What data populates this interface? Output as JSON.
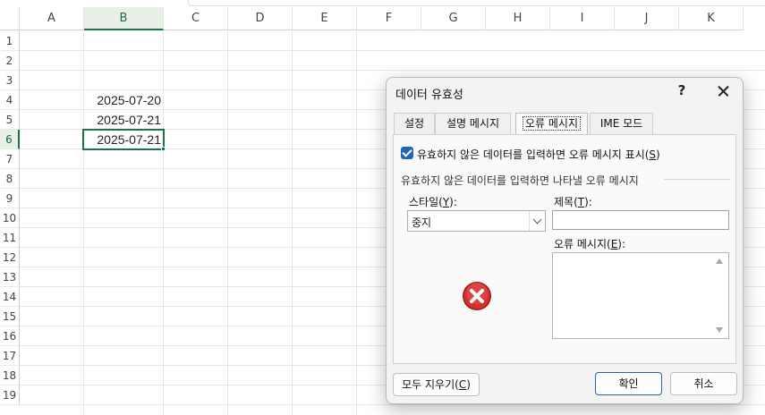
{
  "sheet": {
    "columns": [
      "A",
      "B",
      "C",
      "D",
      "E",
      "F",
      "G",
      "H",
      "I",
      "J",
      "K"
    ],
    "rows": [
      "1",
      "2",
      "3",
      "4",
      "5",
      "6",
      "7",
      "8",
      "9",
      "10",
      "11",
      "12",
      "13",
      "14",
      "15",
      "16",
      "17",
      "18",
      "19"
    ],
    "selected_column": "B",
    "selected_row": "6",
    "cells": [
      {
        "ref": "B4",
        "value": "2025-07-20"
      },
      {
        "ref": "B5",
        "value": "2025-07-21"
      },
      {
        "ref": "B6",
        "value": "2025-07-21"
      }
    ],
    "accent_color": "#1e7145"
  },
  "dialog": {
    "title": "데이터 유효성",
    "help_label": "?",
    "close_icon": "close-icon",
    "tabs": [
      {
        "label": "설정"
      },
      {
        "label": "설명 메시지"
      },
      {
        "label": "오류 메시지",
        "active": true
      },
      {
        "label": "IME 모드"
      }
    ],
    "checkbox": {
      "label": "유효하지 않은 데이터를 입력하면 오류 메시지 표시(",
      "mnemonic": "S",
      "suffix": ")",
      "checked": true
    },
    "group_label": "유효하지 않은 데이터를 입력하면 나타낼 오류 메시지",
    "style_label": {
      "text": "스타일(",
      "mnemonic": "Y",
      "suffix": "):"
    },
    "style_value": "중지",
    "title_label": {
      "text": "제목(",
      "mnemonic": "T",
      "suffix": "):"
    },
    "title_value": "",
    "message_label": {
      "text": "오류 메시지(",
      "mnemonic": "E",
      "suffix": "):"
    },
    "message_value": "",
    "error_icon": "stop-error-icon",
    "clear_button": {
      "text": "모두 지우기(",
      "mnemonic": "C",
      "suffix": ")"
    },
    "ok_label": "확인",
    "cancel_label": "취소",
    "primary_color": "#2166b5",
    "error_color": "#c62828"
  }
}
